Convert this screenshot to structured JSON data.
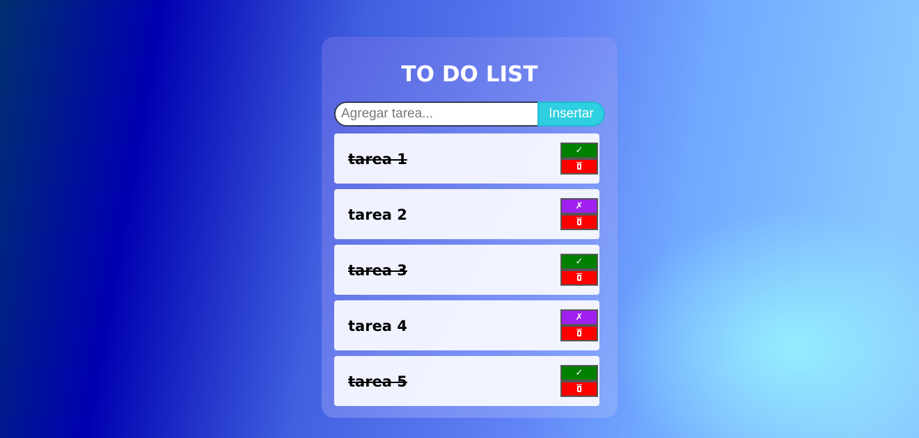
{
  "title": "TO DO LIST",
  "form": {
    "placeholder": "Agregar tarea...",
    "value": "",
    "submit_label": "Insertar"
  },
  "tasks": [
    {
      "label": "tarea 1",
      "completed": true,
      "toggle_icon": "✓",
      "toggle_icon_name": "check-icon",
      "delete_icon_name": "trash-icon"
    },
    {
      "label": "tarea 2",
      "completed": false,
      "toggle_icon": "✗",
      "toggle_icon_name": "cross-icon",
      "delete_icon_name": "trash-icon"
    },
    {
      "label": "tarea 3",
      "completed": true,
      "toggle_icon": "✓",
      "toggle_icon_name": "check-icon",
      "delete_icon_name": "trash-icon"
    },
    {
      "label": "tarea 4",
      "completed": false,
      "toggle_icon": "✗",
      "toggle_icon_name": "cross-icon",
      "delete_icon_name": "trash-icon"
    },
    {
      "label": "tarea 5",
      "completed": true,
      "toggle_icon": "✓",
      "toggle_icon_name": "check-icon",
      "delete_icon_name": "trash-icon"
    }
  ],
  "colors": {
    "accent": "#2ecfe0",
    "done_button": "#008000",
    "undo_button": "#a020f0",
    "delete_button": "#ff0000"
  }
}
